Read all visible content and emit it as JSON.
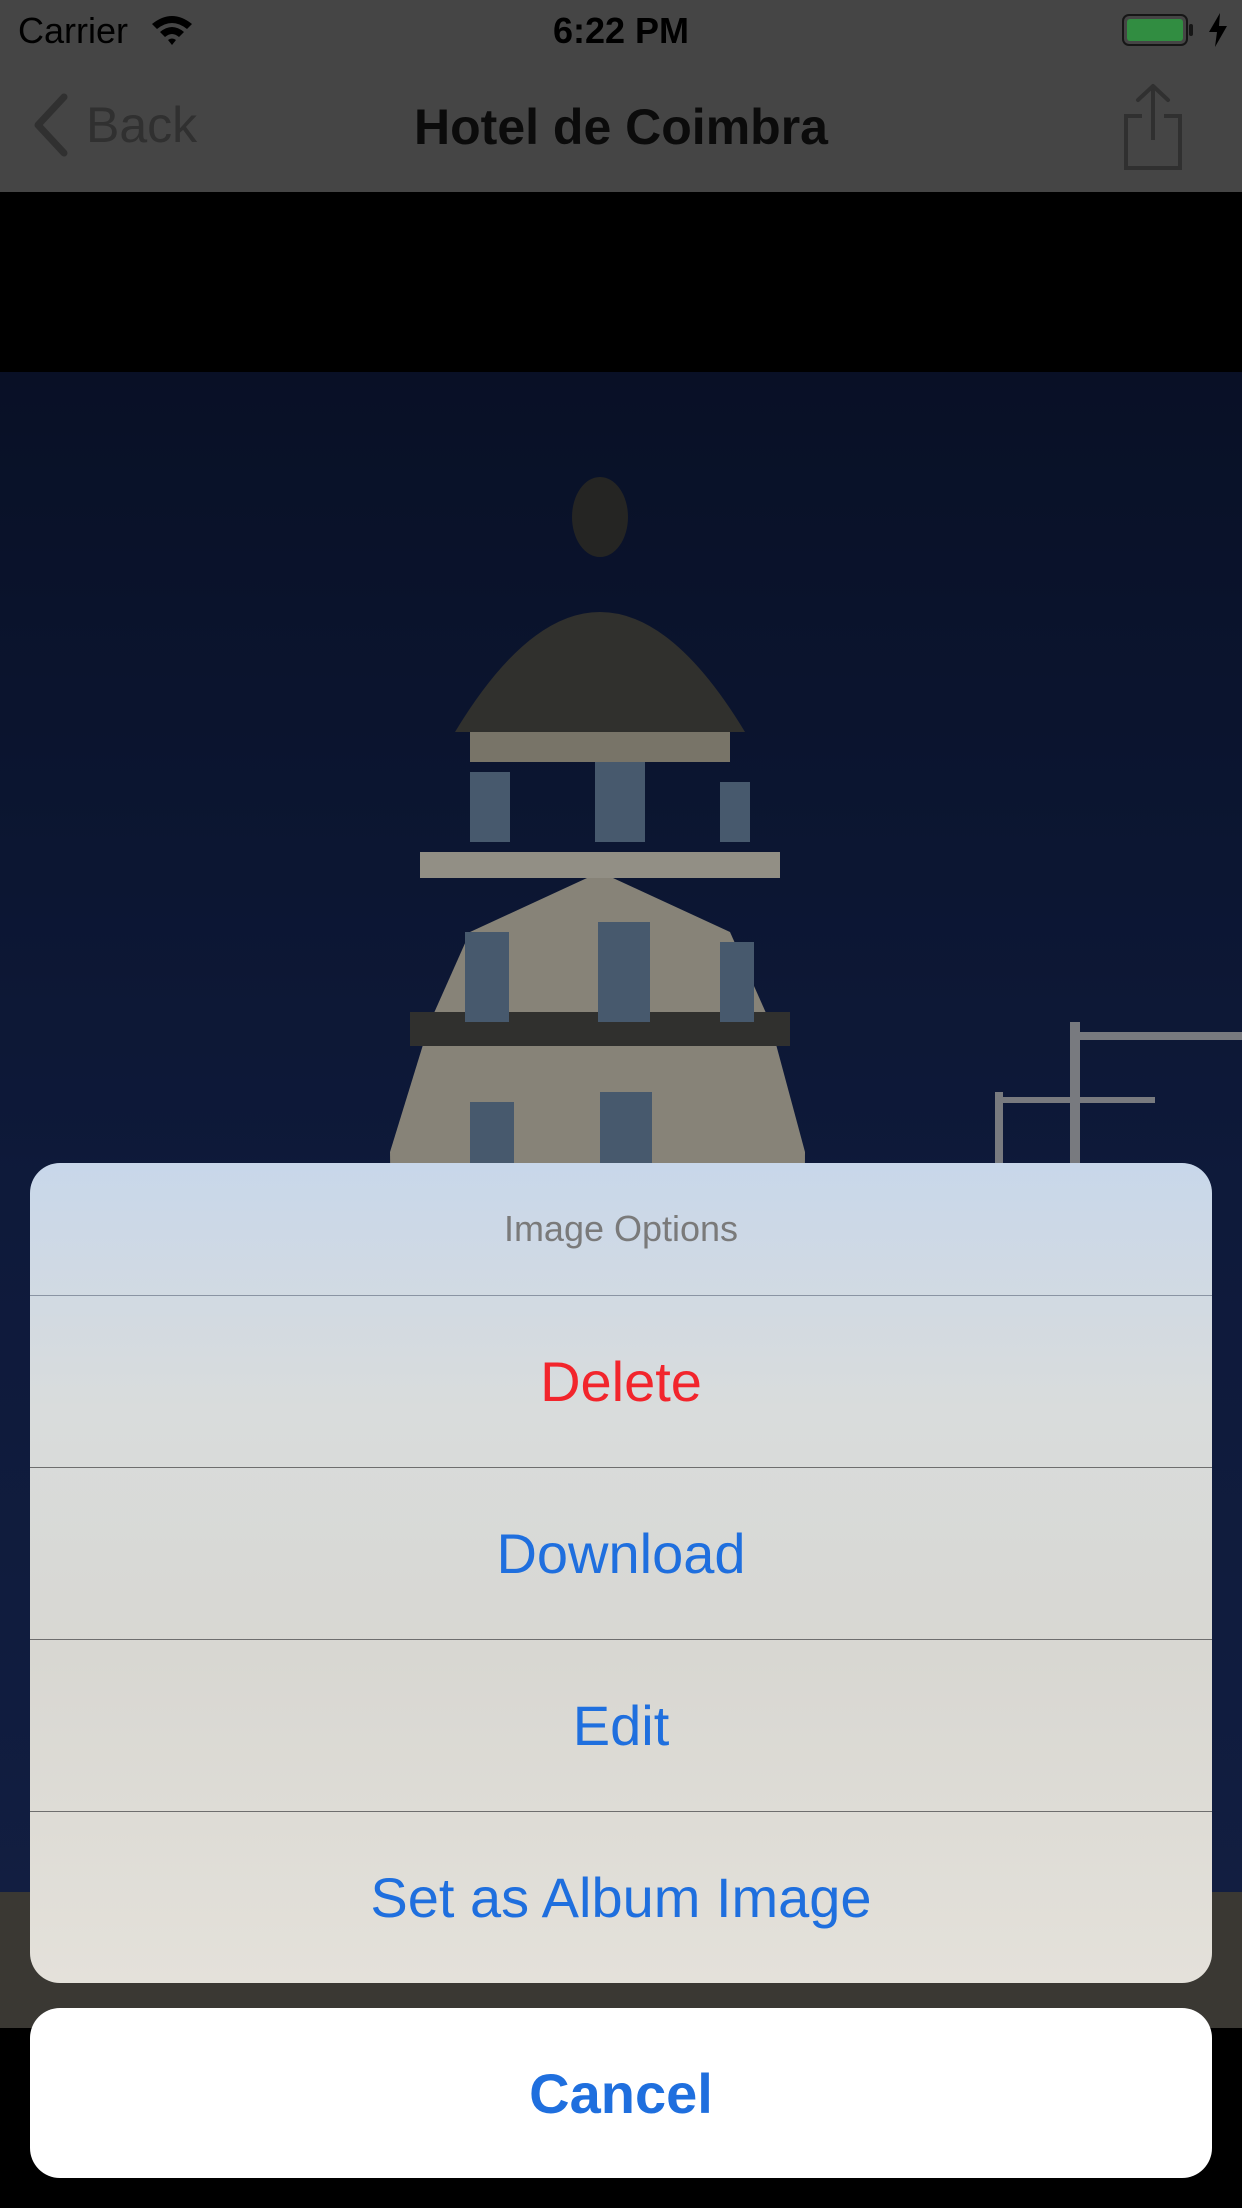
{
  "status_bar": {
    "carrier": "Carrier",
    "time": "6:22 PM"
  },
  "nav": {
    "back_label": "Back",
    "title": "Hotel de Coimbra"
  },
  "action_sheet": {
    "title": "Image Options",
    "options": [
      {
        "label": "Delete",
        "style": "destructive"
      },
      {
        "label": "Download",
        "style": "default"
      },
      {
        "label": "Edit",
        "style": "default"
      },
      {
        "label": "Set as Album Image",
        "style": "default"
      }
    ],
    "cancel_label": "Cancel"
  },
  "colors": {
    "tint": "#1f6fde",
    "destructive": "#f2252c"
  },
  "icons": [
    "wifi-icon",
    "battery-icon",
    "charging-bolt-icon",
    "chevron-left-icon",
    "share-icon"
  ]
}
